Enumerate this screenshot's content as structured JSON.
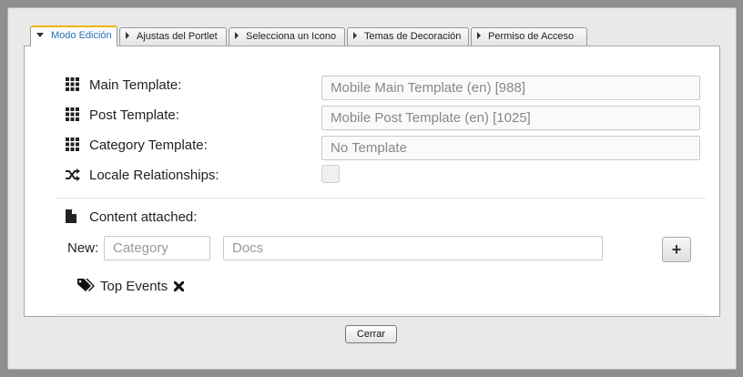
{
  "tabs": [
    {
      "label": "Modo Edición",
      "active": true
    },
    {
      "label": "Ajustas del Portlet"
    },
    {
      "label": "Selecciona un Icono"
    },
    {
      "label": "Temas de Decoración"
    },
    {
      "label": "Permiso de Acceso"
    }
  ],
  "form": {
    "main_template_label": "Main Template:",
    "main_template_value": "Mobile Main Template (en) [988]",
    "post_template_label": "Post Template:",
    "post_template_value": "Mobile Post Template (en) [1025]",
    "category_template_label": "Category Template:",
    "category_template_value": "No Template",
    "locale_label": "Locale Relationships:",
    "locale_checked": false,
    "content_label": "Content attached:",
    "new_label": "New:",
    "category_placeholder": "Category",
    "docs_placeholder": "Docs",
    "add_label": "+",
    "tags": [
      {
        "label": "Top Events"
      }
    ]
  },
  "footer": {
    "close_label": "Cerrar"
  },
  "icons": {
    "grid": "grid-icon",
    "shuffle": "shuffle-icon",
    "file": "file-icon",
    "tags": "tags-icon",
    "remove": "remove-icon"
  },
  "colors": {
    "active_tab_text": "#2b6fba",
    "active_tab_accent": "#f0b400"
  }
}
